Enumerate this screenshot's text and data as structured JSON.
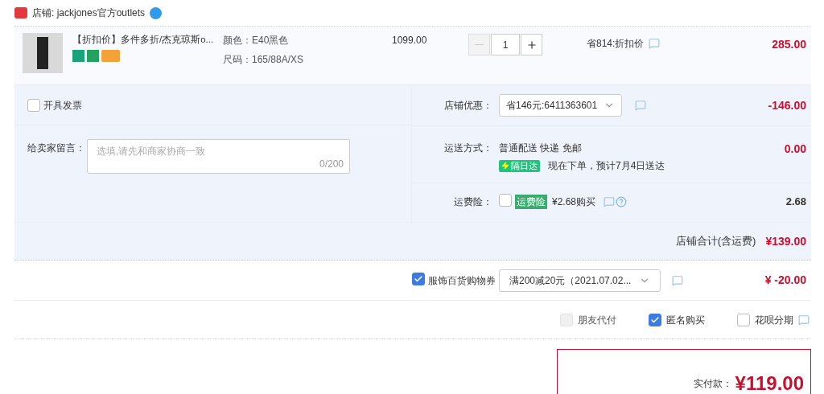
{
  "store": {
    "label": "店铺: jackjones官方outlets"
  },
  "item": {
    "title": "【折扣价】多件多折/杰克琼斯o...",
    "attributes": [
      "颜色：E40黑色",
      "尺码：165/88A/XS"
    ],
    "price": "1099.00",
    "quantity": "1",
    "minus_disabled": true,
    "promo": "省814:折扣价",
    "total": "285.00"
  },
  "invoice": {
    "label": "开具发票",
    "checked": false
  },
  "message": {
    "label": "给卖家留言：",
    "placeholder": "选填,请先和商家协商一致",
    "counter": "0/200"
  },
  "store_discount": {
    "label": "店铺优惠：",
    "value": "省146元:6411363601",
    "amount": "-146.00"
  },
  "shipping": {
    "label": "运送方式：",
    "method": "普通配送 快递 免邮",
    "badge": "隔日达",
    "note": "现在下单，预计7月4日送达",
    "amount": "0.00"
  },
  "insurance": {
    "label": "运费险：",
    "checked": false,
    "tag": "运费险",
    "price": "¥2.68购买",
    "amount": "2.68"
  },
  "store_total": {
    "label": "店铺合计(含运费)",
    "amount": "¥139.00"
  },
  "coupon": {
    "checked": true,
    "label": "服饰百货购物券",
    "value": "满200减20元（2021.07.02...",
    "amount": "¥ -20.00"
  },
  "options": [
    {
      "label": "朋友代付",
      "checked": false,
      "disabled": true
    },
    {
      "label": "匿名购买",
      "checked": true,
      "disabled": false
    },
    {
      "label": "花呗分期",
      "checked": false,
      "disabled": false
    }
  ],
  "payment": {
    "label": "实付款：",
    "amount": "¥119.00"
  }
}
